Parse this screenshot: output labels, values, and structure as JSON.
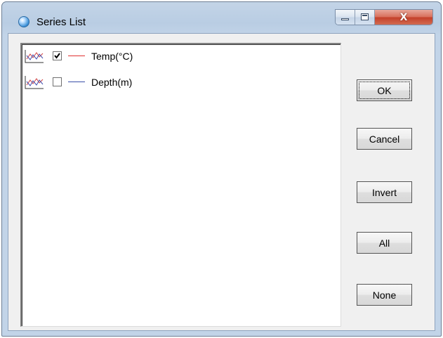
{
  "window": {
    "title": "Series List",
    "app_icon": "globe-icon",
    "caption_buttons": {
      "minimize_icon": "minimize-icon",
      "maximize_icon": "maximize-icon",
      "close_icon": "close-icon",
      "close_glyph": "X"
    }
  },
  "series": [
    {
      "label": "Temp(°C)",
      "checked": true,
      "color": "#e03030",
      "icon": "line-chart-icon"
    },
    {
      "label": "Depth(m)",
      "checked": false,
      "color": "#3a4fa8",
      "icon": "line-chart-icon"
    }
  ],
  "buttons": {
    "ok": "OK",
    "cancel": "Cancel",
    "invert": "Invert",
    "all": "All",
    "none": "None"
  }
}
